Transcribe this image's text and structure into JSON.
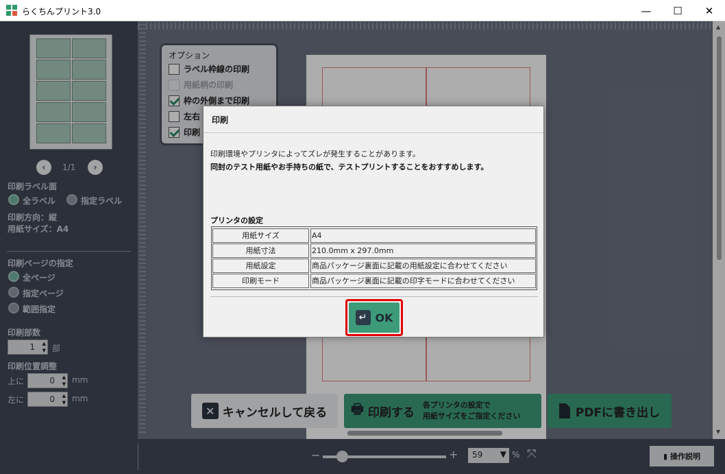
{
  "window": {
    "title": "らくちんプリント3.0",
    "minimize": "—",
    "maximize": "☐",
    "close": "✕"
  },
  "left": {
    "page_indicator": "1/1",
    "label_face_heading": "印刷ラベル面",
    "label_face_options": [
      "全ラベル",
      "指定ラベル"
    ],
    "orientation": "印刷方向：縦",
    "paper_size": "用紙サイズ：A4",
    "page_spec_heading": "印刷ページの指定",
    "page_options": [
      "全ページ",
      "指定ページ",
      "範囲指定"
    ],
    "copies_heading": "印刷部数",
    "copies_value": "1",
    "copies_unit": "部",
    "position_heading": "印刷位置調整",
    "top_label": "上に",
    "top_value": "0",
    "left_label": "左に",
    "left_value": "0",
    "unit": "mm"
  },
  "options": {
    "heading": "オプション",
    "items": [
      {
        "label": "ラベル枠線の印刷",
        "checked": false,
        "enabled": true
      },
      {
        "label": "用紙柄の印刷",
        "checked": false,
        "enabled": false
      },
      {
        "label": "枠の外側まで印刷",
        "checked": true,
        "enabled": true
      },
      {
        "label": "左右",
        "checked": false,
        "enabled": true
      },
      {
        "label": "印刷",
        "checked": true,
        "enabled": true
      }
    ]
  },
  "actions": {
    "cancel": "キャンセルして戻る",
    "print": "印刷する",
    "print_note_line1": "各プリンタの設定で",
    "print_note_line2": "用紙サイズをご指定ください",
    "pdf": "PDFに書き出し"
  },
  "bottom": {
    "zoom_minus": "−",
    "zoom_plus": "+",
    "zoom_value": "59",
    "zoom_unit": "%",
    "help": "操作説明"
  },
  "dialog": {
    "title": "印刷",
    "message_line1": "印刷環境やプリンタによってズレが発生することがあります。",
    "message_line2": "同封のテスト用紙やお手持ちの紙で、テストプリントすることをおすすめします。",
    "settings_heading": "プリンタの設定",
    "settings": [
      {
        "label": "用紙サイズ",
        "value": "A4"
      },
      {
        "label": "用紙寸法",
        "value": "210.0mm x 297.0mm"
      },
      {
        "label": "用紙設定",
        "value": "商品パッケージ裏面に記載の用紙設定に合わせてください"
      },
      {
        "label": "印刷モード",
        "value": "商品パッケージ裏面に記載の印字モードに合わせてください"
      }
    ],
    "ok_label": "OK",
    "ok_icon": "↵"
  },
  "colors": {
    "panel": "#404757",
    "accent_green": "#3d9b79",
    "highlight_red": "#e00000"
  }
}
